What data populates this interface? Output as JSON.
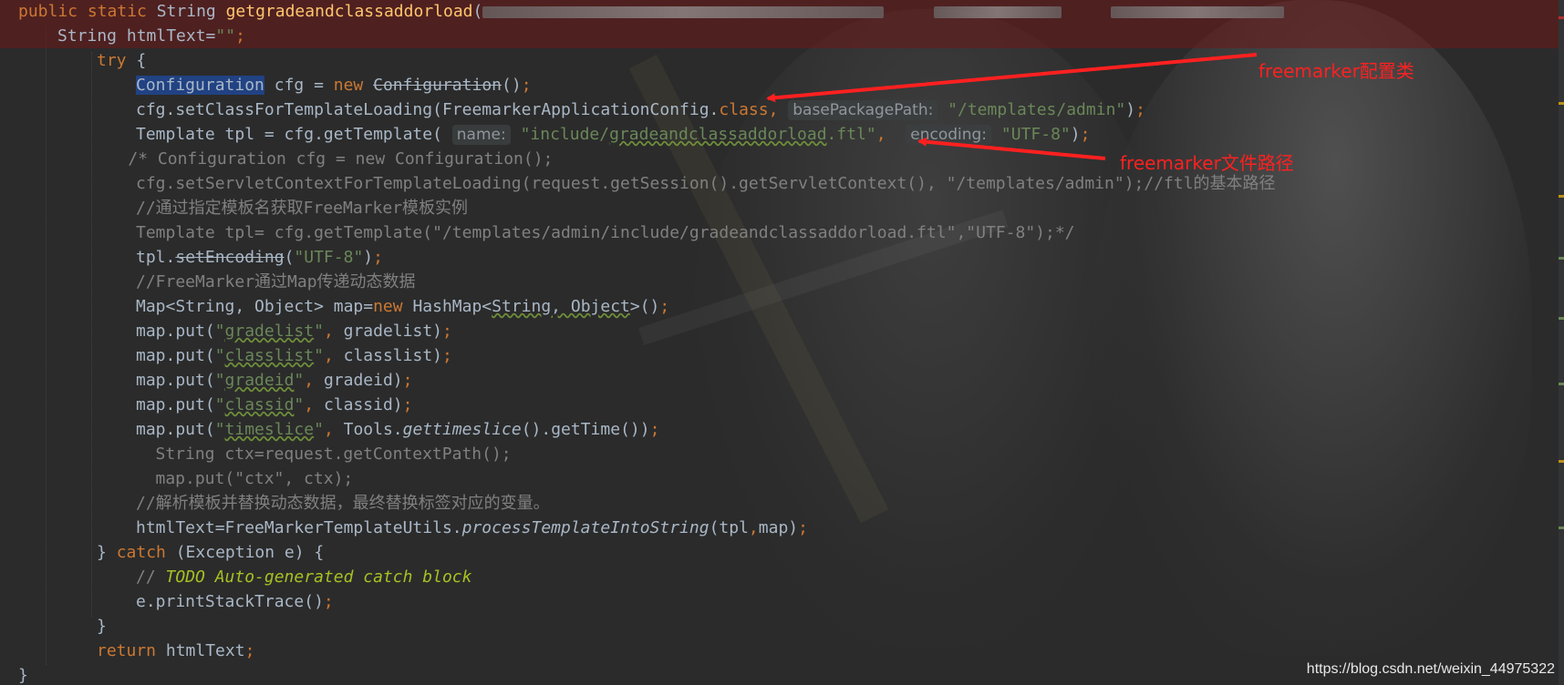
{
  "editor": {
    "lines": [
      {
        "id": "signature",
        "indent": 0,
        "error": true,
        "parts": [
          {
            "t": "kw",
            "v": "public static "
          },
          {
            "t": "plain",
            "v": "String "
          },
          {
            "t": "fn",
            "v": "getgradeandclassaddorload"
          },
          {
            "t": "plain",
            "v": "("
          },
          {
            "t": "blur",
            "w": 440
          },
          {
            "t": "plain",
            "v": "     "
          },
          {
            "t": "blur",
            "w": 140
          },
          {
            "t": "plain",
            "v": "     "
          },
          {
            "t": "blur",
            "w": 190
          }
        ]
      },
      {
        "id": "html-text-decl",
        "indent": 1,
        "error": true,
        "parts": [
          {
            "t": "plain",
            "v": "String htmlText="
          },
          {
            "t": "str",
            "v": "\"\""
          },
          {
            "t": "kw",
            "v": ";"
          }
        ]
      },
      {
        "id": "try-open",
        "indent": 2,
        "parts": [
          {
            "t": "kw",
            "v": "try"
          },
          {
            "t": "plain",
            "v": " {"
          }
        ]
      },
      {
        "id": "cfg-new",
        "indent": 3,
        "parts": [
          {
            "t": "sel",
            "v": "Configuration"
          },
          {
            "t": "plain",
            "v": " cfg = "
          },
          {
            "t": "kw",
            "v": "new "
          },
          {
            "t": "strike",
            "v": "Configuration"
          },
          {
            "t": "plain",
            "v": "()"
          },
          {
            "t": "kw",
            "v": ";"
          }
        ]
      },
      {
        "id": "cfg-set-class",
        "indent": 3,
        "parts": [
          {
            "t": "plain",
            "v": "cfg.setClassForTemplateLoading(FreemarkerApplicationConfig."
          },
          {
            "t": "kw",
            "v": "class"
          },
          {
            "t": "kw",
            "v": ", "
          },
          {
            "t": "hint",
            "v": "basePackagePath:"
          },
          {
            "t": "plain",
            "v": " "
          },
          {
            "t": "str",
            "v": "\"/templates/admin\""
          },
          {
            "t": "plain",
            "v": ")"
          },
          {
            "t": "kw",
            "v": ";"
          }
        ]
      },
      {
        "id": "tpl-get",
        "indent": 3,
        "parts": [
          {
            "t": "plain",
            "v": "Template tpl = cfg.getTemplate( "
          },
          {
            "t": "hint",
            "v": "name:"
          },
          {
            "t": "plain",
            "v": " "
          },
          {
            "t": "str",
            "v": "\"include/"
          },
          {
            "t": "str-wavy",
            "v": "gradeandclassaddorload"
          },
          {
            "t": "str",
            "v": ".ftl\""
          },
          {
            "t": "kw",
            "v": ",  "
          },
          {
            "t": "hint",
            "v": "encoding:"
          },
          {
            "t": "plain",
            "v": " "
          },
          {
            "t": "str",
            "v": "\"UTF-8\""
          },
          {
            "t": "plain",
            "v": ")"
          },
          {
            "t": "kw",
            "v": ";"
          }
        ]
      },
      {
        "id": "cmt-block-1",
        "indent": 2.8,
        "parts": [
          {
            "t": "cmt",
            "v": "/* Configuration cfg = new Configuration();"
          }
        ]
      },
      {
        "id": "cmt-block-2",
        "indent": 3,
        "parts": [
          {
            "t": "cmt",
            "v": "cfg.setServletContextForTemplateLoading(request.getSession().getServletContext(), \"/templates/admin\");//ftl的基本路径"
          }
        ]
      },
      {
        "id": "cmt-block-3",
        "indent": 3,
        "parts": [
          {
            "t": "cmt",
            "v": "//通过指定模板名获取FreeMarker模板实例"
          }
        ]
      },
      {
        "id": "cmt-block-4",
        "indent": 3,
        "parts": [
          {
            "t": "cmt",
            "v": "Template tpl= cfg.getTemplate(\"/templates/admin/include/gradeandclassaddorload.ftl\",\"UTF-8\");*/"
          }
        ]
      },
      {
        "id": "tpl-set-encoding",
        "indent": 3,
        "parts": [
          {
            "t": "plain",
            "v": "tpl."
          },
          {
            "t": "strike",
            "v": "setEncoding"
          },
          {
            "t": "plain",
            "v": "("
          },
          {
            "t": "str",
            "v": "\"UTF-8\""
          },
          {
            "t": "plain",
            "v": ")"
          },
          {
            "t": "kw",
            "v": ";"
          }
        ]
      },
      {
        "id": "cmt-map",
        "indent": 3,
        "parts": [
          {
            "t": "cmt",
            "v": "//FreeMarker通过Map传递动态数据"
          }
        ]
      },
      {
        "id": "map-new",
        "indent": 3,
        "parts": [
          {
            "t": "plain",
            "v": "Map<String, Object> map="
          },
          {
            "t": "kw",
            "v": "new "
          },
          {
            "t": "plain",
            "v": "HashMap<"
          },
          {
            "t": "plain-wavy",
            "v": "String, Object"
          },
          {
            "t": "plain",
            "v": ">()"
          },
          {
            "t": "kw",
            "v": ";"
          }
        ]
      },
      {
        "id": "put-gradelist",
        "indent": 3,
        "parts": [
          {
            "t": "plain",
            "v": "map.put("
          },
          {
            "t": "str",
            "v": "\""
          },
          {
            "t": "str-wavy",
            "v": "gradelist"
          },
          {
            "t": "str",
            "v": "\""
          },
          {
            "t": "kw",
            "v": ", "
          },
          {
            "t": "plain",
            "v": "gradelist)"
          },
          {
            "t": "kw",
            "v": ";"
          }
        ]
      },
      {
        "id": "put-classlist",
        "indent": 3,
        "parts": [
          {
            "t": "plain",
            "v": "map.put("
          },
          {
            "t": "str",
            "v": "\""
          },
          {
            "t": "str-wavy",
            "v": "classlist"
          },
          {
            "t": "str",
            "v": "\""
          },
          {
            "t": "kw",
            "v": ", "
          },
          {
            "t": "plain",
            "v": "classlist)"
          },
          {
            "t": "kw",
            "v": ";"
          }
        ]
      },
      {
        "id": "put-gradeid",
        "indent": 3,
        "parts": [
          {
            "t": "plain",
            "v": "map.put("
          },
          {
            "t": "str",
            "v": "\""
          },
          {
            "t": "str-wavy",
            "v": "gradeid"
          },
          {
            "t": "str",
            "v": "\""
          },
          {
            "t": "kw",
            "v": ", "
          },
          {
            "t": "plain",
            "v": "gradeid)"
          },
          {
            "t": "kw",
            "v": ";"
          }
        ]
      },
      {
        "id": "put-classid",
        "indent": 3,
        "parts": [
          {
            "t": "plain",
            "v": "map.put("
          },
          {
            "t": "str",
            "v": "\""
          },
          {
            "t": "str-wavy",
            "v": "classid"
          },
          {
            "t": "str",
            "v": "\""
          },
          {
            "t": "kw",
            "v": ", "
          },
          {
            "t": "plain",
            "v": "classid)"
          },
          {
            "t": "kw",
            "v": ";"
          }
        ]
      },
      {
        "id": "put-timeslice",
        "indent": 3,
        "parts": [
          {
            "t": "plain",
            "v": "map.put("
          },
          {
            "t": "str",
            "v": "\""
          },
          {
            "t": "str-wavy",
            "v": "timeslice"
          },
          {
            "t": "str",
            "v": "\""
          },
          {
            "t": "kw",
            "v": ", "
          },
          {
            "t": "plain",
            "v": "Tools."
          },
          {
            "t": "it",
            "v": "gettimeslice"
          },
          {
            "t": "plain",
            "v": "().getTime())"
          },
          {
            "t": "kw",
            "v": ";"
          }
        ]
      },
      {
        "id": "cmt-ctx-1",
        "indent": 3.5,
        "parts": [
          {
            "t": "cmt",
            "v": "String ctx=request.getContextPath();"
          }
        ]
      },
      {
        "id": "cmt-ctx-2",
        "indent": 3.5,
        "parts": [
          {
            "t": "cmt",
            "v": "map.put(\"ctx\", ctx);"
          }
        ]
      },
      {
        "id": "cmt-parse",
        "indent": 3,
        "parts": [
          {
            "t": "cmt",
            "v": "//解析模板并替换动态数据，最终替换标签对应的变量。"
          }
        ]
      },
      {
        "id": "process-template",
        "indent": 3,
        "parts": [
          {
            "t": "plain",
            "v": "htmlText=FreeMarkerTemplateUtils."
          },
          {
            "t": "it",
            "v": "processTemplateIntoString"
          },
          {
            "t": "plain",
            "v": "(tpl"
          },
          {
            "t": "kw",
            "v": ","
          },
          {
            "t": "plain",
            "v": "map)"
          },
          {
            "t": "kw",
            "v": ";"
          }
        ]
      },
      {
        "id": "catch",
        "indent": 2,
        "parts": [
          {
            "t": "plain",
            "v": "} "
          },
          {
            "t": "kw",
            "v": "catch "
          },
          {
            "t": "plain",
            "v": "(Exception e) {"
          }
        ]
      },
      {
        "id": "todo",
        "indent": 3,
        "parts": [
          {
            "t": "cmt",
            "v": "// "
          },
          {
            "t": "todo",
            "v": "TODO Auto-generated catch block"
          }
        ]
      },
      {
        "id": "print-stack",
        "indent": 3,
        "parts": [
          {
            "t": "plain",
            "v": "e.printStackTrace()"
          },
          {
            "t": "kw",
            "v": ";"
          }
        ]
      },
      {
        "id": "close-catch",
        "indent": 2,
        "parts": [
          {
            "t": "plain",
            "v": "}"
          }
        ]
      },
      {
        "id": "return",
        "indent": 2,
        "parts": [
          {
            "t": "kw",
            "v": "return "
          },
          {
            "t": "plain",
            "v": "htmlText"
          },
          {
            "t": "kw",
            "v": ";"
          }
        ]
      },
      {
        "id": "close-method",
        "indent": 0,
        "parts": [
          {
            "t": "plain",
            "v": "}"
          }
        ]
      }
    ]
  },
  "annotations": {
    "config_note": "freemarker配置类",
    "path_note": "freemarker文件路径"
  },
  "watermark": "https://blog.csdn.net/weixin_44975322",
  "colors": {
    "background": "#2b2b2b",
    "keyword": "#cc7832",
    "string": "#6a8759",
    "comment": "#808080",
    "method": "#ffc66d",
    "text": "#a9b7c6",
    "annotation": "#ff2020"
  }
}
